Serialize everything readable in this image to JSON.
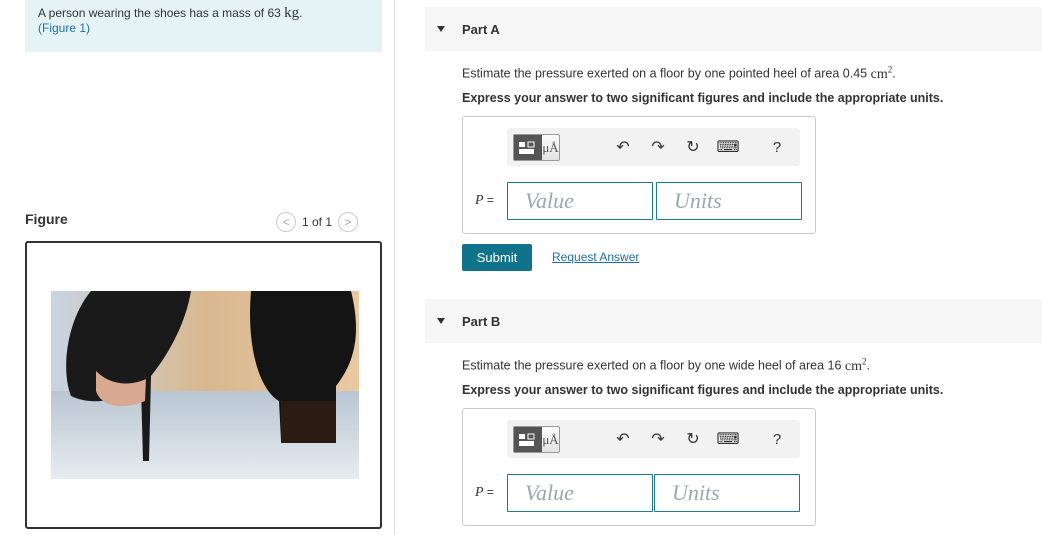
{
  "intro": {
    "text": "A person wearing the shoes has a mass of 63",
    "unit": "kg",
    "period": ".",
    "figure_link": "(Figure 1)"
  },
  "figure": {
    "label": "Figure",
    "pager": {
      "prev": "<",
      "text": "1 of 1",
      "next": ">"
    },
    "image_alt": "Photo of two high-heeled shoes: one pointed heel, one wide heel"
  },
  "parts": [
    {
      "title": "Part A",
      "question_prefix": "Estimate the pressure exerted on a floor by one pointed heel of area 0.45",
      "area_unit": "cm",
      "area_exp": "2",
      "instruction": "Express your answer to two significant figures and include the appropriate units.",
      "variable": "P",
      "equals": "=",
      "value_placeholder": "Value",
      "units_placeholder": "Units",
      "submit_label": "Submit",
      "request_label": "Request Answer"
    },
    {
      "title": "Part B",
      "question_prefix": "Estimate the pressure exerted on a floor by one wide heel of area 16",
      "area_unit": "cm",
      "area_exp": "2",
      "instruction": "Express your answer to two significant figures and include the appropriate units.",
      "variable": "P",
      "equals": "=",
      "value_placeholder": "Value",
      "units_placeholder": "Units"
    }
  ],
  "toolbar": {
    "units_symbol": "μÅ",
    "undo": "↶",
    "redo": "↷",
    "reset": "↻",
    "keyboard": "⌨",
    "help": "?"
  }
}
